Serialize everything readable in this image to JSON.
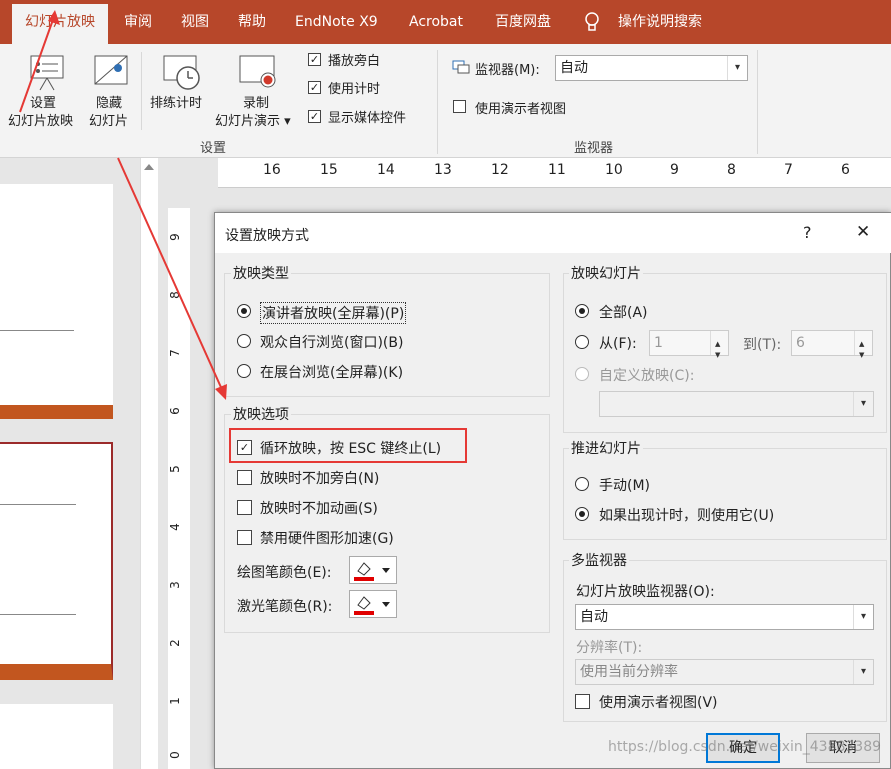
{
  "tabs": [
    "幻灯片放映",
    "审阅",
    "视图",
    "帮助",
    "EndNote X9",
    "Acrobat",
    "百度网盘",
    "操作说明搜索"
  ],
  "ribbon": {
    "setup_label1": "设置",
    "setup_label2": "幻灯片放映",
    "hide_label1": "隐藏",
    "hide_label2": "幻灯片",
    "rehearse_label": "排练计时",
    "record_label1": "录制",
    "record_label2": "幻灯片演示",
    "play_narration": "播放旁白",
    "use_timings": "使用计时",
    "show_media": "显示媒体控件",
    "group_setup": "设置",
    "monitor_label": "监视器(M):",
    "monitor_value": "自动",
    "presenter_view": "使用演示者视图",
    "group_monitor": "监视器"
  },
  "ruler": {
    "h": [
      "16",
      "15",
      "14",
      "13",
      "12",
      "11",
      "10",
      "9",
      "8",
      "7",
      "6"
    ],
    "v": [
      "9",
      "8",
      "7",
      "6",
      "5",
      "4",
      "3",
      "2",
      "1",
      "0"
    ]
  },
  "dialog": {
    "title": "设置放映方式",
    "help": "?",
    "close": "✕",
    "show_type": {
      "title": "放映类型",
      "options": [
        "演讲者放映(全屏幕)(P)",
        "观众自行浏览(窗口)(B)",
        "在展台浏览(全屏幕)(K)"
      ]
    },
    "show_options": {
      "title": "放映选项",
      "loop": "循环放映，按 ESC 键终止(L)",
      "no_narration": "放映时不加旁白(N)",
      "no_animation": "放映时不加动画(S)",
      "disable_hw": "禁用硬件图形加速(G)",
      "pen_color": "绘图笔颜色(E):",
      "laser_color": "激光笔颜色(R):"
    },
    "show_slides": {
      "title": "放映幻灯片",
      "all": "全部(A)",
      "from": "从(F):",
      "from_value": "1",
      "to": "到(T):",
      "to_value": "6",
      "custom": "自定义放映(C):"
    },
    "advance": {
      "title": "推进幻灯片",
      "manual": "手动(M)",
      "timings": "如果出现计时，则使用它(U)"
    },
    "multi_monitor": {
      "title": "多监视器",
      "monitor_label": "幻灯片放映监视器(O):",
      "monitor_value": "自动",
      "resolution_label": "分辨率(T):",
      "resolution_value": "使用当前分辨率",
      "presenter_view": "使用演示者视图(V)"
    },
    "ok": "确定",
    "cancel": "取消"
  },
  "watermark": "https://blog.csdn.net/weixin_43883389",
  "colors": {
    "accent": "#b7472a",
    "highlight": "#e53935",
    "pen": "#e00000"
  }
}
